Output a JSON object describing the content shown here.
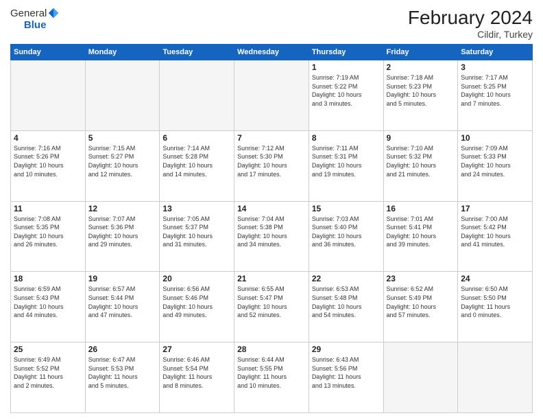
{
  "header": {
    "logo_general": "General",
    "logo_blue": "Blue",
    "title": "February 2024",
    "location": "Cildir, Turkey"
  },
  "weekdays": [
    "Sunday",
    "Monday",
    "Tuesday",
    "Wednesday",
    "Thursday",
    "Friday",
    "Saturday"
  ],
  "weeks": [
    [
      {
        "num": "",
        "info": "",
        "empty": true
      },
      {
        "num": "",
        "info": "",
        "empty": true
      },
      {
        "num": "",
        "info": "",
        "empty": true
      },
      {
        "num": "",
        "info": "",
        "empty": true
      },
      {
        "num": "1",
        "info": "Sunrise: 7:19 AM\nSunset: 5:22 PM\nDaylight: 10 hours\nand 3 minutes.",
        "empty": false
      },
      {
        "num": "2",
        "info": "Sunrise: 7:18 AM\nSunset: 5:23 PM\nDaylight: 10 hours\nand 5 minutes.",
        "empty": false
      },
      {
        "num": "3",
        "info": "Sunrise: 7:17 AM\nSunset: 5:25 PM\nDaylight: 10 hours\nand 7 minutes.",
        "empty": false
      }
    ],
    [
      {
        "num": "4",
        "info": "Sunrise: 7:16 AM\nSunset: 5:26 PM\nDaylight: 10 hours\nand 10 minutes.",
        "empty": false
      },
      {
        "num": "5",
        "info": "Sunrise: 7:15 AM\nSunset: 5:27 PM\nDaylight: 10 hours\nand 12 minutes.",
        "empty": false
      },
      {
        "num": "6",
        "info": "Sunrise: 7:14 AM\nSunset: 5:28 PM\nDaylight: 10 hours\nand 14 minutes.",
        "empty": false
      },
      {
        "num": "7",
        "info": "Sunrise: 7:12 AM\nSunset: 5:30 PM\nDaylight: 10 hours\nand 17 minutes.",
        "empty": false
      },
      {
        "num": "8",
        "info": "Sunrise: 7:11 AM\nSunset: 5:31 PM\nDaylight: 10 hours\nand 19 minutes.",
        "empty": false
      },
      {
        "num": "9",
        "info": "Sunrise: 7:10 AM\nSunset: 5:32 PM\nDaylight: 10 hours\nand 21 minutes.",
        "empty": false
      },
      {
        "num": "10",
        "info": "Sunrise: 7:09 AM\nSunset: 5:33 PM\nDaylight: 10 hours\nand 24 minutes.",
        "empty": false
      }
    ],
    [
      {
        "num": "11",
        "info": "Sunrise: 7:08 AM\nSunset: 5:35 PM\nDaylight: 10 hours\nand 26 minutes.",
        "empty": false
      },
      {
        "num": "12",
        "info": "Sunrise: 7:07 AM\nSunset: 5:36 PM\nDaylight: 10 hours\nand 29 minutes.",
        "empty": false
      },
      {
        "num": "13",
        "info": "Sunrise: 7:05 AM\nSunset: 5:37 PM\nDaylight: 10 hours\nand 31 minutes.",
        "empty": false
      },
      {
        "num": "14",
        "info": "Sunrise: 7:04 AM\nSunset: 5:38 PM\nDaylight: 10 hours\nand 34 minutes.",
        "empty": false
      },
      {
        "num": "15",
        "info": "Sunrise: 7:03 AM\nSunset: 5:40 PM\nDaylight: 10 hours\nand 36 minutes.",
        "empty": false
      },
      {
        "num": "16",
        "info": "Sunrise: 7:01 AM\nSunset: 5:41 PM\nDaylight: 10 hours\nand 39 minutes.",
        "empty": false
      },
      {
        "num": "17",
        "info": "Sunrise: 7:00 AM\nSunset: 5:42 PM\nDaylight: 10 hours\nand 41 minutes.",
        "empty": false
      }
    ],
    [
      {
        "num": "18",
        "info": "Sunrise: 6:59 AM\nSunset: 5:43 PM\nDaylight: 10 hours\nand 44 minutes.",
        "empty": false
      },
      {
        "num": "19",
        "info": "Sunrise: 6:57 AM\nSunset: 5:44 PM\nDaylight: 10 hours\nand 47 minutes.",
        "empty": false
      },
      {
        "num": "20",
        "info": "Sunrise: 6:56 AM\nSunset: 5:46 PM\nDaylight: 10 hours\nand 49 minutes.",
        "empty": false
      },
      {
        "num": "21",
        "info": "Sunrise: 6:55 AM\nSunset: 5:47 PM\nDaylight: 10 hours\nand 52 minutes.",
        "empty": false
      },
      {
        "num": "22",
        "info": "Sunrise: 6:53 AM\nSunset: 5:48 PM\nDaylight: 10 hours\nand 54 minutes.",
        "empty": false
      },
      {
        "num": "23",
        "info": "Sunrise: 6:52 AM\nSunset: 5:49 PM\nDaylight: 10 hours\nand 57 minutes.",
        "empty": false
      },
      {
        "num": "24",
        "info": "Sunrise: 6:50 AM\nSunset: 5:50 PM\nDaylight: 11 hours\nand 0 minutes.",
        "empty": false
      }
    ],
    [
      {
        "num": "25",
        "info": "Sunrise: 6:49 AM\nSunset: 5:52 PM\nDaylight: 11 hours\nand 2 minutes.",
        "empty": false
      },
      {
        "num": "26",
        "info": "Sunrise: 6:47 AM\nSunset: 5:53 PM\nDaylight: 11 hours\nand 5 minutes.",
        "empty": false
      },
      {
        "num": "27",
        "info": "Sunrise: 6:46 AM\nSunset: 5:54 PM\nDaylight: 11 hours\nand 8 minutes.",
        "empty": false
      },
      {
        "num": "28",
        "info": "Sunrise: 6:44 AM\nSunset: 5:55 PM\nDaylight: 11 hours\nand 10 minutes.",
        "empty": false
      },
      {
        "num": "29",
        "info": "Sunrise: 6:43 AM\nSunset: 5:56 PM\nDaylight: 11 hours\nand 13 minutes.",
        "empty": false
      },
      {
        "num": "",
        "info": "",
        "empty": true
      },
      {
        "num": "",
        "info": "",
        "empty": true
      }
    ]
  ]
}
